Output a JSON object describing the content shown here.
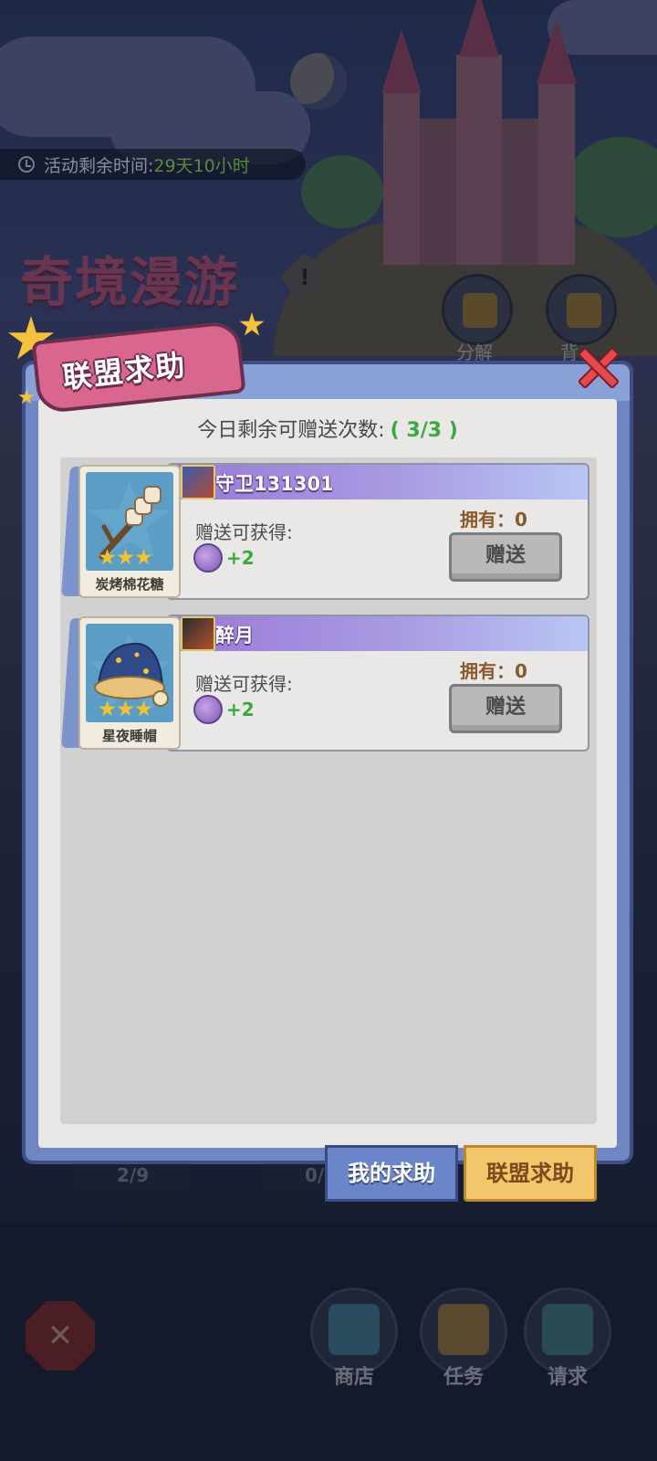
{
  "background": {
    "event_timer_label": "活动剩余时间:",
    "event_timer_value": "29天10小时",
    "event_title": "奇境漫游",
    "info_icon": "!",
    "side_buttons": [
      {
        "label": "分解",
        "icon": "hammer-icon"
      },
      {
        "label": "背",
        "icon": "backpack-icon"
      }
    ],
    "progress_left": "2/9",
    "progress_right": "0/",
    "nav": [
      {
        "label": "商店",
        "icon": "shop-icon"
      },
      {
        "label": "任务",
        "icon": "task-clipboard-icon"
      },
      {
        "label": "请求",
        "icon": "bottle-icon"
      }
    ],
    "close_glyph": "✕"
  },
  "dialog": {
    "title": "联盟求助",
    "count_label": "今日剩余可赠送次数:",
    "count_value": "( 3/3 )",
    "requests": [
      {
        "player_name": "守卫131301",
        "item_name": "炭烤棉花糖",
        "item_stars": 3,
        "reward_label": "赠送可获得:",
        "reward_value": "+2",
        "owned_label": "拥有：0",
        "give_button": "赠送"
      },
      {
        "player_name": "醉月",
        "item_name": "星夜睡帽",
        "item_stars": 3,
        "reward_label": "赠送可获得:",
        "reward_value": "+2",
        "owned_label": "拥有：0",
        "give_button": "赠送"
      }
    ],
    "tabs": {
      "my_requests": "我的求助",
      "alliance_requests": "联盟求助"
    }
  },
  "colors": {
    "accent_green": "#3aa83c",
    "dialog_blue": "#6f86c2",
    "banner_pink": "#d9668c",
    "active_tab_yellow": "#f2c66a"
  }
}
